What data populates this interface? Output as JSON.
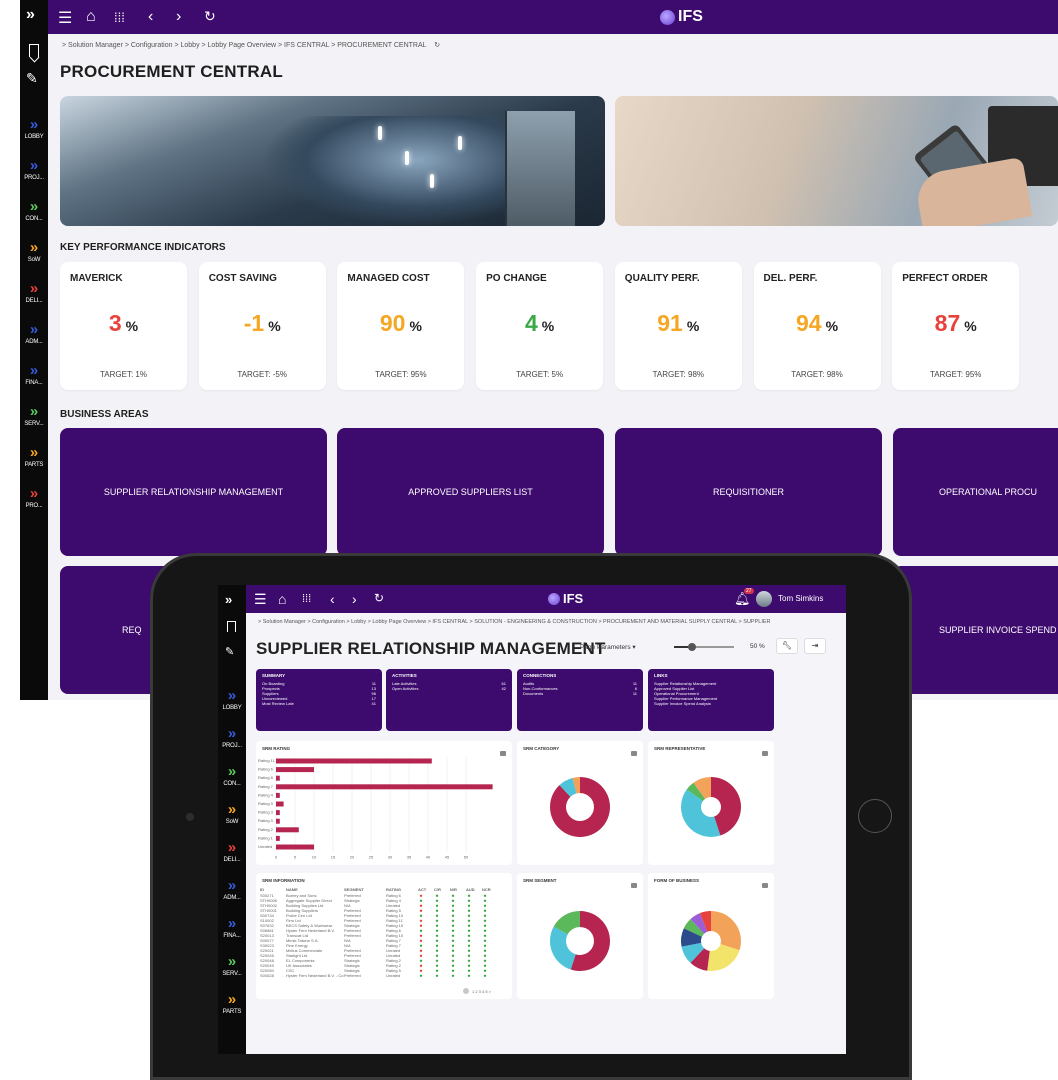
{
  "background": {
    "app_logo": "IFS",
    "rail": {
      "items": [
        {
          "label": "LOBBY",
          "color": "#3a5bd9"
        },
        {
          "label": "PROJ...",
          "color": "#3a5bd9"
        },
        {
          "label": "CON...",
          "color": "#5ec95e"
        },
        {
          "label": "SoW",
          "color": "#f5a623"
        },
        {
          "label": "DELI...",
          "color": "#e8423c"
        },
        {
          "label": "ADM...",
          "color": "#3a5bd9"
        },
        {
          "label": "FINA...",
          "color": "#3a5bd9"
        },
        {
          "label": "SERV...",
          "color": "#5ec95e"
        },
        {
          "label": "PARTS",
          "color": "#f5a623"
        },
        {
          "label": "PRO...",
          "color": "#e8423c"
        }
      ]
    },
    "breadcrumb": "> Solution Manager > Configuration > Lobby > Lobby Page Overview > IFS CENTRAL > PROCUREMENT CENTRAL",
    "page_title": "PROCUREMENT CENTRAL",
    "kpi_heading": "KEY PERFORMANCE INDICATORS",
    "kpis": [
      {
        "title": "MAVERICK",
        "value": "3",
        "unit": "%",
        "target": "TARGET: 1%",
        "color": "#e8423c"
      },
      {
        "title": "COST SAVING",
        "value": "-1",
        "unit": "%",
        "target": "TARGET: -5%",
        "color": "#f5a623"
      },
      {
        "title": "MANAGED COST",
        "value": "90",
        "unit": "%",
        "target": "TARGET: 95%",
        "color": "#f5a623"
      },
      {
        "title": "PO CHANGE",
        "value": "4",
        "unit": "%",
        "target": "TARGET: 5%",
        "color": "#3aa845"
      },
      {
        "title": "QUALITY PERF.",
        "value": "91",
        "unit": "%",
        "target": "TARGET: 98%",
        "color": "#f5a623"
      },
      {
        "title": "DEL. PERF.",
        "value": "94",
        "unit": "%",
        "target": "TARGET: 98%",
        "color": "#f5a623"
      },
      {
        "title": "PERFECT ORDER",
        "value": "87",
        "unit": "%",
        "target": "TARGET: 95%",
        "color": "#e8423c"
      }
    ],
    "areas_heading": "BUSINESS AREAS",
    "areas": [
      "SUPPLIER RELATIONSHIP MANAGEMENT",
      "APPROVED SUPPLIERS LIST",
      "REQUISITIONER",
      "OPERATIONAL PROCU",
      "REQ",
      "SUPPLIER INVOICE SPEND"
    ]
  },
  "tablet": {
    "app_logo": "IFS",
    "notification_count": "27",
    "user_name": "Tom Simkins",
    "rail": [
      {
        "label": "LOBBY",
        "color": "#3a5bd9"
      },
      {
        "label": "PROJ...",
        "color": "#3a5bd9"
      },
      {
        "label": "CON...",
        "color": "#5ec95e"
      },
      {
        "label": "SoW",
        "color": "#f5a623"
      },
      {
        "label": "DELI...",
        "color": "#e8423c"
      },
      {
        "label": "ADM...",
        "color": "#3a5bd9"
      },
      {
        "label": "FINA...",
        "color": "#3a5bd9"
      },
      {
        "label": "SERV...",
        "color": "#5ec95e"
      },
      {
        "label": "PARTS",
        "color": "#f5a623"
      }
    ],
    "breadcrumb": "> Solution Manager > Configuration > Lobby > Lobby Page Overview > IFS CENTRAL > SOLUTION - ENGINEERING & CONSTRUCTION > PROCUREMENT AND MATERIAL SUPPLY CENTRAL > SUPPLIER",
    "page_title": "SUPPLIER RELATIONSHIP MANAGEMENT",
    "page_params": "Page Parameters",
    "zoom": "50 %",
    "summary": {
      "title": "SUMMARY",
      "rows": [
        [
          "On Boarding",
          "11"
        ],
        [
          "Prospects",
          "13"
        ],
        [
          "Suppliers",
          "96"
        ],
        [
          "Uncoreviewed",
          "17"
        ],
        [
          "Most Review Late",
          "41"
        ]
      ]
    },
    "activities": {
      "title": "ACTIVITIES",
      "rows": [
        [
          "Late Activities",
          "61"
        ],
        [
          "Open Activities",
          "42"
        ]
      ]
    },
    "connections": {
      "title": "CONNECTIONS",
      "rows": [
        [
          "Audits",
          "11"
        ],
        [
          "Non-Conformances",
          "6"
        ],
        [
          "Documents",
          "11"
        ]
      ]
    },
    "links": {
      "title": "LINKS",
      "items": [
        "Supplier Relationship Management",
        "Approved Supplier List",
        "Operational Procurement",
        "Supplier Performance Management",
        "Supplier Invoice Spend Analysis"
      ]
    },
    "srm_rating": {
      "title": "SRM RATING",
      "categories": [
        "Rating 11",
        "Rating 6",
        "Rating 8",
        "Rating 7",
        "Rating 4",
        "Rating 9",
        "Rating 3",
        "Rating 5",
        "Rating 2",
        "Rating 1",
        "Unrated"
      ],
      "values": [
        41,
        10,
        1,
        57,
        1,
        2,
        1,
        1,
        6,
        1,
        10
      ],
      "ticks": [
        "0",
        "5",
        "10",
        "15",
        "20",
        "25",
        "30",
        "35",
        "40",
        "45",
        "50"
      ]
    },
    "srm_category": {
      "title": "SRM CATEGORY",
      "slices": [
        {
          "color": "#b5254f",
          "value": 88
        },
        {
          "color": "#4ec3d9",
          "value": 8
        },
        {
          "color": "#f3a25a",
          "value": 4
        }
      ]
    },
    "srm_representative": {
      "title": "SRM REPRESENTATIVE",
      "slices": [
        {
          "color": "#b5254f",
          "value": 45
        },
        {
          "color": "#4ec3d9",
          "value": 40
        },
        {
          "color": "#5bb85b",
          "value": 5
        },
        {
          "color": "#f3a25a",
          "value": 10
        }
      ]
    },
    "srm_segment": {
      "title": "SRM SEGMENT",
      "slices": [
        {
          "color": "#b5254f",
          "value": 55
        },
        {
          "color": "#4ec3d9",
          "value": 28
        },
        {
          "color": "#5bb85b",
          "value": 17
        }
      ]
    },
    "form_of_business": {
      "title": "FORM OF BUSINESS",
      "slices": [
        {
          "color": "#f3a25a",
          "value": 30
        },
        {
          "color": "#f2e36b",
          "value": 22
        },
        {
          "color": "#b5254f",
          "value": 10
        },
        {
          "color": "#4ec3d9",
          "value": 10
        },
        {
          "color": "#2c4a8c",
          "value": 10
        },
        {
          "color": "#5bb85b",
          "value": 6
        },
        {
          "color": "#9c5ed6",
          "value": 6
        },
        {
          "color": "#e8423c",
          "value": 6
        }
      ]
    },
    "srm_information": {
      "title": "SRM INFORMATION",
      "headers": [
        "ID",
        "NAME",
        "SEGMENT",
        "RATING",
        "ACT",
        "C/R",
        "N/R",
        "AUD",
        "NCR"
      ],
      "rows": [
        [
          "S00271",
          "Bumey and Sons",
          "Preferred",
          "Rating 6"
        ],
        [
          "STH0006",
          "Aggregate Supplier Direct",
          "Strategic",
          "Rating 4"
        ],
        [
          "STH0002",
          "Building Supplies Ltd",
          "N/A",
          "Unrated"
        ],
        [
          "STH0001",
          "Building Suppliers",
          "Preferred",
          "Rating 5"
        ],
        [
          "S00734",
          "Probe Cen Ltd",
          "Preferred",
          "Rating 10"
        ],
        [
          "S10002",
          "Firm Ltd",
          "Preferred",
          "Rating 11"
        ],
        [
          "S07632",
          "BSCS Safety & Workwear",
          "Strategic",
          "Rating 10"
        ],
        [
          "S06881",
          "Hyster Fern Nederland B.V.",
          "Preferred",
          "Rating 6"
        ],
        [
          "S20013",
          "Transcat Ltd",
          "Preferred",
          "Rating 10"
        ],
        [
          "S00077",
          "Mimik Taiwne S.A.",
          "N/A",
          "Rating 7"
        ],
        [
          "S30023",
          "Pine Energy",
          "N/A",
          "Rating 7"
        ],
        [
          "S20021",
          "Melius Commercials",
          "Preferred",
          "Unrated"
        ],
        [
          "S20045",
          "Starlight Ltd",
          "Preferred",
          "Unrated"
        ],
        [
          "S20048",
          "EL Components",
          "Strategic",
          "Rating 2"
        ],
        [
          "S20049",
          "UK Associates",
          "Strategic",
          "Rating 2"
        ],
        [
          "S20050",
          "CSC",
          "Strategic",
          "Rating 5"
        ],
        [
          "S00528",
          "Hyster Fern Nederland B.V. - Co",
          "Preferred",
          "Unrated"
        ]
      ],
      "pager": "1 2 3 4 5 >"
    }
  }
}
